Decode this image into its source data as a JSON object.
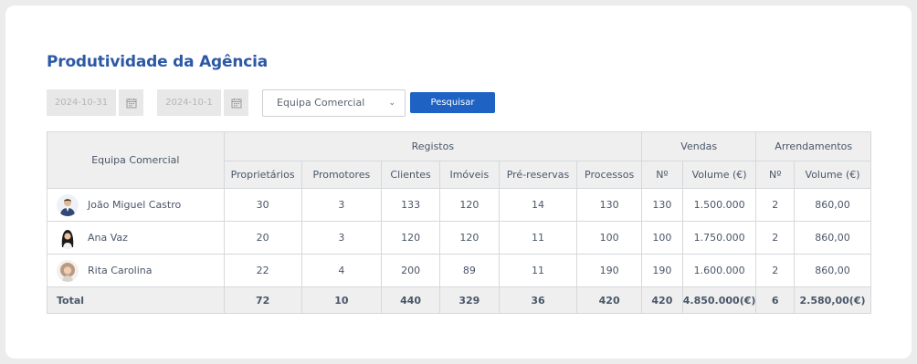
{
  "page": {
    "title": "Produtividade da Agência"
  },
  "filters": {
    "date_from": "2024-10-31",
    "date_to": "2024-10-1",
    "team_select": "Equipa Comercial",
    "search_button": "Pesquisar"
  },
  "table": {
    "header": {
      "team": "Equipa Comercial",
      "registos": "Registos",
      "vendas": "Vendas",
      "arrendamentos": "Arrendamentos",
      "proprietarios": "Proprietários",
      "promotores": "Promotores",
      "clientes": "Clientes",
      "imoveis": "Imóveis",
      "pre_reservas": "Pré-reservas",
      "processos": "Processos",
      "vendas_n": "Nº",
      "vendas_volume": "Volume (€)",
      "arr_n": "Nº",
      "arr_volume": "Volume (€)"
    },
    "rows": [
      {
        "name": "João Miguel Castro",
        "avatar": "man-suit-avatar",
        "proprietarios": "30",
        "promotores": "3",
        "clientes": "133",
        "imoveis": "120",
        "pre_reservas": "14",
        "processos": "130",
        "vendas_n": "130",
        "vendas_volume": "1.500.000",
        "arr_n": "2",
        "arr_volume": "860,00"
      },
      {
        "name": "Ana Vaz",
        "avatar": "woman-dark-hair-avatar",
        "proprietarios": "20",
        "promotores": "3",
        "clientes": "120",
        "imoveis": "120",
        "pre_reservas": "11",
        "processos": "100",
        "vendas_n": "100",
        "vendas_volume": "1.750.000",
        "arr_n": "2",
        "arr_volume": "860,00"
      },
      {
        "name": "Rita Carolina",
        "avatar": "woman-curly-hair-avatar",
        "proprietarios": "22",
        "promotores": "4",
        "clientes": "200",
        "imoveis": "89",
        "pre_reservas": "11",
        "processos": "190",
        "vendas_n": "190",
        "vendas_volume": "1.600.000",
        "arr_n": "2",
        "arr_volume": "860,00"
      }
    ],
    "total": {
      "label": "Total",
      "proprietarios": "72",
      "promotores": "10",
      "clientes": "440",
      "imoveis": "329",
      "pre_reservas": "36",
      "processos": "420",
      "vendas_n": "420",
      "vendas_volume": "4.850.000(€)",
      "arr_n": "6",
      "arr_volume": "2.580,00(€)"
    }
  },
  "colors": {
    "title": "#2d58a5",
    "button": "#1e62c4",
    "header_bg": "#efefef"
  }
}
